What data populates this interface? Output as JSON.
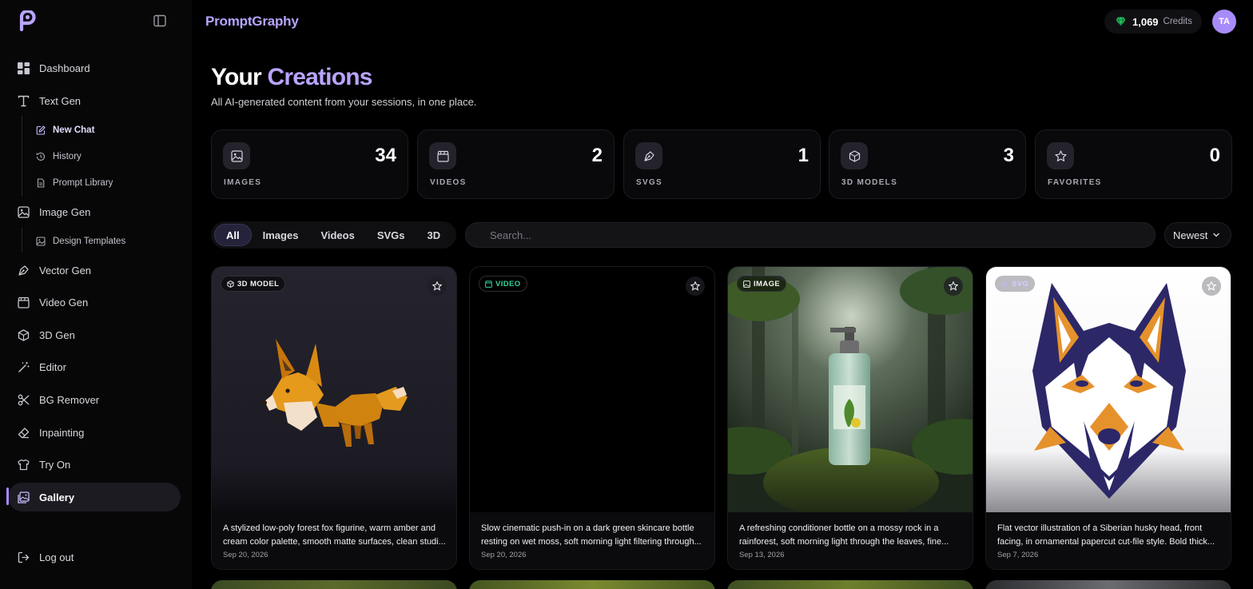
{
  "app": {
    "brand": "PromptGraphy"
  },
  "topbar": {
    "credits_value": "1,069",
    "credits_label": "Credits",
    "avatar_initials": "TA"
  },
  "sidebar": {
    "items": [
      {
        "label": "Dashboard",
        "icon": "dashboard-icon"
      },
      {
        "label": "Text Gen",
        "icon": "text-icon"
      },
      {
        "label": "Image Gen",
        "icon": "image-icon"
      },
      {
        "label": "Vector Gen",
        "icon": "pen-tool-icon"
      },
      {
        "label": "Video Gen",
        "icon": "clapperboard-icon"
      },
      {
        "label": "3D Gen",
        "icon": "cube-icon"
      },
      {
        "label": "Editor",
        "icon": "magic-wand-icon"
      },
      {
        "label": "BG Remover",
        "icon": "scissors-icon"
      },
      {
        "label": "Inpainting",
        "icon": "eraser-icon"
      },
      {
        "label": "Try On",
        "icon": "shirt-icon"
      },
      {
        "label": "Gallery",
        "icon": "gallery-icon",
        "active": true
      }
    ],
    "text_gen_sub": [
      {
        "label": "New Chat",
        "icon": "edit-icon",
        "active": true
      },
      {
        "label": "History",
        "icon": "history-icon"
      },
      {
        "label": "Prompt Library",
        "icon": "document-icon"
      }
    ],
    "image_gen_sub": [
      {
        "label": "Design Templates",
        "icon": "template-icon"
      }
    ],
    "logout": "Log out"
  },
  "header": {
    "title_part1": "Your",
    "title_part2": "Creations",
    "subtitle": "All AI-generated content from your sessions, in one place."
  },
  "stats": [
    {
      "label": "IMAGES",
      "value": "34",
      "icon": "image-icon"
    },
    {
      "label": "VIDEOS",
      "value": "2",
      "icon": "clapperboard-icon"
    },
    {
      "label": "SVGS",
      "value": "1",
      "icon": "pen-tool-icon"
    },
    {
      "label": "3D MODELS",
      "value": "3",
      "icon": "cube-icon"
    },
    {
      "label": "FAVORITES",
      "value": "0",
      "icon": "star-icon"
    }
  ],
  "filters": {
    "tabs": [
      "All",
      "Images",
      "Videos",
      "SVGs",
      "3D"
    ],
    "active_tab": "All",
    "search_placeholder": "Search...",
    "sort_label": "Newest"
  },
  "cards": [
    {
      "type": "3D MODEL",
      "description": "A stylized low-poly forest fox figurine, warm amber and cream color palette, smooth matte surfaces, clean studi...",
      "date": "Sep 20, 2026"
    },
    {
      "type": "VIDEO",
      "description": "Slow cinematic push-in on a dark green skincare bottle resting on wet moss, soft morning light filtering through...",
      "date": "Sep 20, 2026"
    },
    {
      "type": "IMAGE",
      "description": "A refreshing conditioner bottle on a mossy rock in a rainforest, soft morning light through the leaves, fine...",
      "date": "Sep 13, 2026"
    },
    {
      "type": "SVG",
      "description": "Flat vector illustration of a Siberian husky head, front facing, in ornamental papercut cut-file style. Bold thick...",
      "date": "Sep 7, 2026"
    }
  ],
  "colors": {
    "accent": "#a78bfa",
    "brand": "#b9a4ff",
    "video_badge": "#34d399",
    "svg_badge": "#c4b5fd"
  }
}
